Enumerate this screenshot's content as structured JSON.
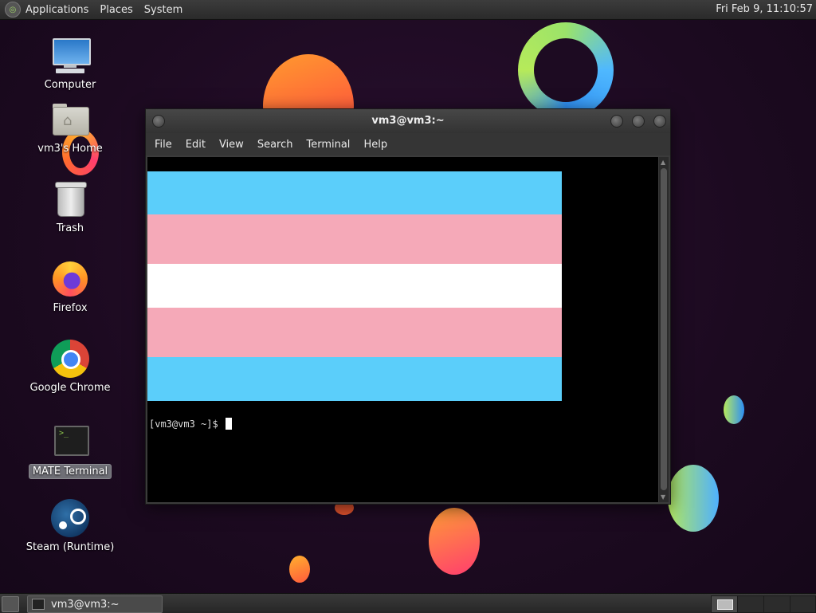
{
  "top_panel": {
    "menus": [
      "Applications",
      "Places",
      "System"
    ],
    "clock": "Fri Feb  9, 11:10:57"
  },
  "desktop_icons": [
    {
      "label": "Computer",
      "icon": "computer-icon"
    },
    {
      "label": "vm3's Home",
      "icon": "home-folder-icon"
    },
    {
      "label": "Trash",
      "icon": "trash-icon"
    },
    {
      "label": "Firefox",
      "icon": "firefox-icon"
    },
    {
      "label": "Google Chrome",
      "icon": "chrome-icon"
    },
    {
      "label": "MATE Terminal",
      "icon": "terminal-icon",
      "selected": true
    },
    {
      "label": "Steam (Runtime)",
      "icon": "steam-icon"
    }
  ],
  "terminal_window": {
    "title": "vm3@vm3:~",
    "menu": [
      "File",
      "Edit",
      "View",
      "Search",
      "Terminal",
      "Help"
    ],
    "image_stripes": [
      "#5bcefa",
      "#f5a9b8",
      "#ffffff",
      "#f5a9b8",
      "#5bcefa"
    ],
    "prompt": "[vm3@vm3 ~]$"
  },
  "taskbar": {
    "window_button": "vm3@vm3:~"
  }
}
